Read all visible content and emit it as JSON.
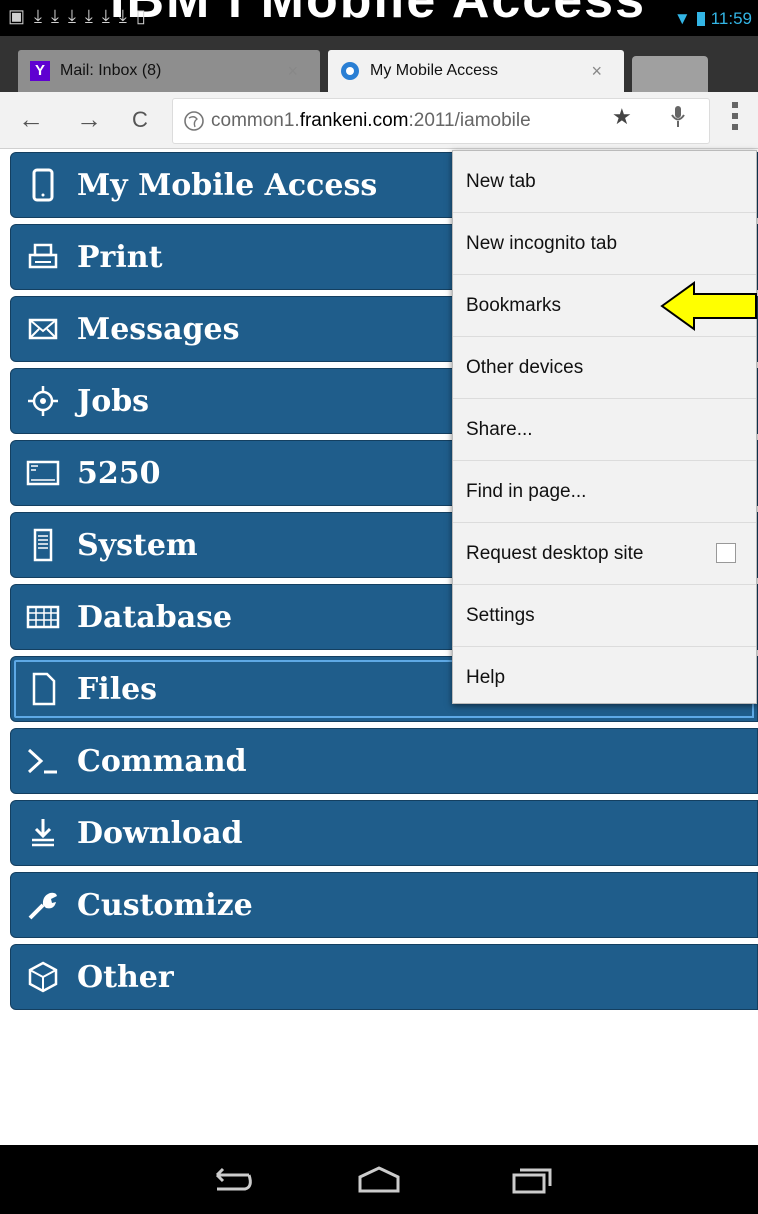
{
  "status_bar": {
    "overlay_title": "IBM i Mobile Access",
    "time": "11:59",
    "notification_icons": [
      "image-icon",
      "download-icon",
      "download-icon",
      "download-icon",
      "download-icon",
      "download-icon",
      "download-icon",
      "sim-icon"
    ]
  },
  "browser": {
    "tabs": [
      {
        "label": "Mail: Inbox (8)",
        "icon": "yahoo-icon",
        "active": false
      },
      {
        "label": "My Mobile Access",
        "icon": "globe-favicon",
        "active": true
      }
    ],
    "url_prefix": "common1.",
    "url_host": "frankeni.com",
    "url_suffix": ":2011/iamobile",
    "close_glyph": "×"
  },
  "menu": {
    "items": [
      {
        "label": "My Mobile Access",
        "icon": "phone-icon"
      },
      {
        "label": "Print",
        "icon": "printer-icon"
      },
      {
        "label": "Messages",
        "icon": "envelope-icon"
      },
      {
        "label": "Jobs",
        "icon": "gear-target-icon"
      },
      {
        "label": "5250",
        "icon": "terminal-screen-icon"
      },
      {
        "label": "System",
        "icon": "server-icon"
      },
      {
        "label": "Database",
        "icon": "table-icon"
      },
      {
        "label": "Files",
        "icon": "file-icon"
      },
      {
        "label": "Command",
        "icon": "prompt-icon"
      },
      {
        "label": "Download",
        "icon": "download-tray-icon"
      },
      {
        "label": "Customize",
        "icon": "wrench-icon"
      },
      {
        "label": "Other",
        "icon": "cube-icon"
      }
    ]
  },
  "dropdown": {
    "items": [
      {
        "label": "New tab"
      },
      {
        "label": "New incognito tab"
      },
      {
        "label": "Bookmarks"
      },
      {
        "label": "Other devices"
      },
      {
        "label": "Share..."
      },
      {
        "label": "Find in page..."
      },
      {
        "label": "Request desktop site",
        "checkbox": true,
        "checked": false
      },
      {
        "label": "Settings"
      },
      {
        "label": "Help"
      }
    ]
  },
  "colors": {
    "menu_item_bg": "#1f5d8b",
    "arrow": "#ffff00",
    "status_accent": "#33b5e5"
  }
}
